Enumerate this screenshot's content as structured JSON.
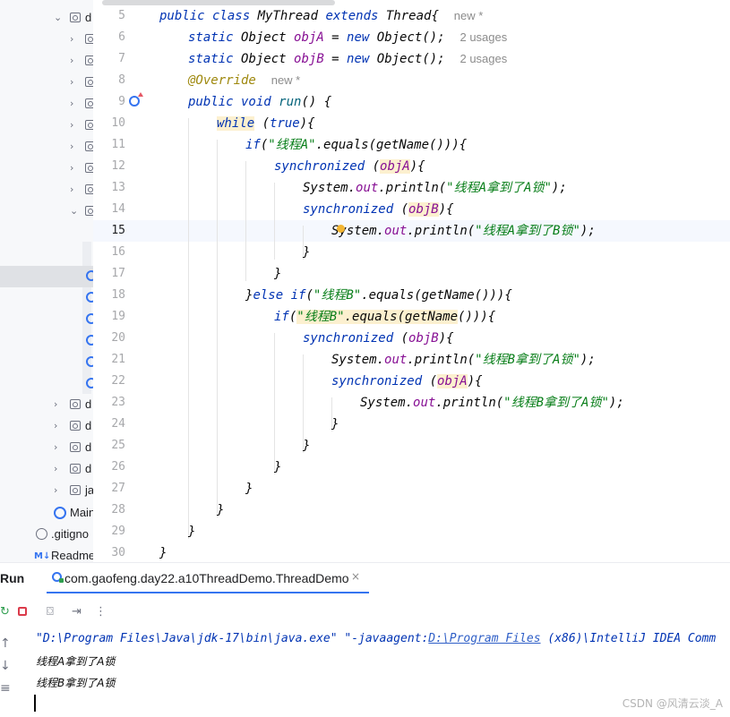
{
  "tree": {
    "items": [
      {
        "label": "d",
        "type": "folder",
        "expanded": true
      },
      {
        "label": "",
        "type": "folder",
        "expanded": false
      },
      {
        "label": "",
        "type": "folder",
        "expanded": false
      },
      {
        "label": "",
        "type": "folder",
        "expanded": false
      },
      {
        "label": "",
        "type": "folder",
        "expanded": false
      },
      {
        "label": "",
        "type": "folder",
        "expanded": false
      },
      {
        "label": "",
        "type": "folder",
        "expanded": false
      },
      {
        "label": "",
        "type": "folder",
        "expanded": false
      },
      {
        "label": "",
        "type": "folder",
        "expanded": false
      },
      {
        "label": "",
        "type": "folder",
        "expanded": true
      },
      {
        "label": "",
        "type": "class"
      },
      {
        "label": "",
        "type": "class"
      },
      {
        "label": "",
        "type": "class"
      },
      {
        "label": "",
        "type": "class"
      },
      {
        "label": "",
        "type": "class"
      },
      {
        "label": "",
        "type": "class"
      },
      {
        "label": "d",
        "type": "folder",
        "expanded": false
      },
      {
        "label": "d",
        "type": "folder",
        "expanded": false
      },
      {
        "label": "d",
        "type": "folder",
        "expanded": false
      },
      {
        "label": "d",
        "type": "folder",
        "expanded": false
      },
      {
        "label": "ja",
        "type": "folder",
        "expanded": false
      },
      {
        "label": "Main",
        "type": "class-main"
      },
      {
        "label": ".gitigno",
        "type": "gitignore"
      },
      {
        "label": "Readme",
        "type": "markdown"
      }
    ]
  },
  "editor": {
    "line_numbers": [
      "5",
      "6",
      "7",
      "8",
      "9",
      "10",
      "11",
      "12",
      "13",
      "14",
      "15",
      "16",
      "17",
      "18",
      "19",
      "20",
      "21",
      "22",
      "23",
      "24",
      "25",
      "26",
      "27",
      "28",
      "29",
      "30"
    ],
    "current_line": "15",
    "hint_new": "new *",
    "hint_usages": "2 usages",
    "lines": {
      "l5": [
        "public class ",
        "MyThread ",
        "extends ",
        "Thread{"
      ],
      "l6": [
        "static ",
        "Object ",
        "objA",
        " = ",
        "new ",
        "Object();"
      ],
      "l7": [
        "static ",
        "Object ",
        "objB",
        " = ",
        "new ",
        "Object();"
      ],
      "l8": [
        "@Override"
      ],
      "l9": [
        "public void ",
        "run",
        "() {"
      ],
      "l10": [
        "while",
        " (",
        "true",
        "){"
      ],
      "l11": [
        "if",
        "(",
        "\"线程A\"",
        ".equals(",
        "getName",
        "())){"
      ],
      "l12": [
        "synchronized",
        " (",
        "objA",
        "){"
      ],
      "l13": [
        "System.",
        "out",
        ".println(",
        "\"线程A拿到了A锁\"",
        ");"
      ],
      "l14": [
        "synchronized",
        " (",
        "objB",
        "){"
      ],
      "l15": [
        "System.",
        "out",
        ".println(",
        "\"线程A拿到了B锁\"",
        ");"
      ],
      "l16": [
        "}"
      ],
      "l17": [
        "}"
      ],
      "l18": [
        "}",
        "else if",
        "(",
        "\"线程B\"",
        ".equals(",
        "getName",
        "())){"
      ],
      "l19": [
        "if",
        "(",
        "\"线程B\"",
        ".equals(",
        "getName",
        "())){"
      ],
      "l20": [
        "synchronized",
        " (",
        "objB",
        "){"
      ],
      "l21": [
        "System.",
        "out",
        ".println(",
        "\"线程B拿到了A锁\"",
        ");"
      ],
      "l22": [
        "synchronized",
        " (",
        "objA",
        "){"
      ],
      "l23": [
        "System.",
        "out",
        ".println(",
        "\"线程B拿到了A锁\"",
        ");"
      ],
      "l24": [
        "}"
      ],
      "l25": [
        "}"
      ],
      "l26": [
        "}"
      ],
      "l27": [
        "}"
      ],
      "l28": [
        "}"
      ],
      "l29": [
        "}"
      ],
      "l30": [
        "}"
      ]
    }
  },
  "run": {
    "title": "Run",
    "tab_label": "com.gaofeng.day22.a10ThreadDemo.ThreadDemo",
    "close_glyph": "×",
    "command": {
      "part1": "\"D:\\Program Files\\Java\\jdk-17\\bin\\java.exe\" \"-javaagent:",
      "link": "D:\\Program Files",
      "part2": " (x86)\\IntelliJ IDEA Comm"
    },
    "output": [
      "线程A拿到了A锁",
      "线程B拿到了A锁"
    ],
    "watermark": "CSDN @风清云淡_A"
  },
  "colors": {
    "keyword": "#0033b3",
    "string": "#067d17",
    "field": "#871094",
    "method": "#00627a",
    "annotation": "#9e880d",
    "accent": "#3574f0"
  }
}
